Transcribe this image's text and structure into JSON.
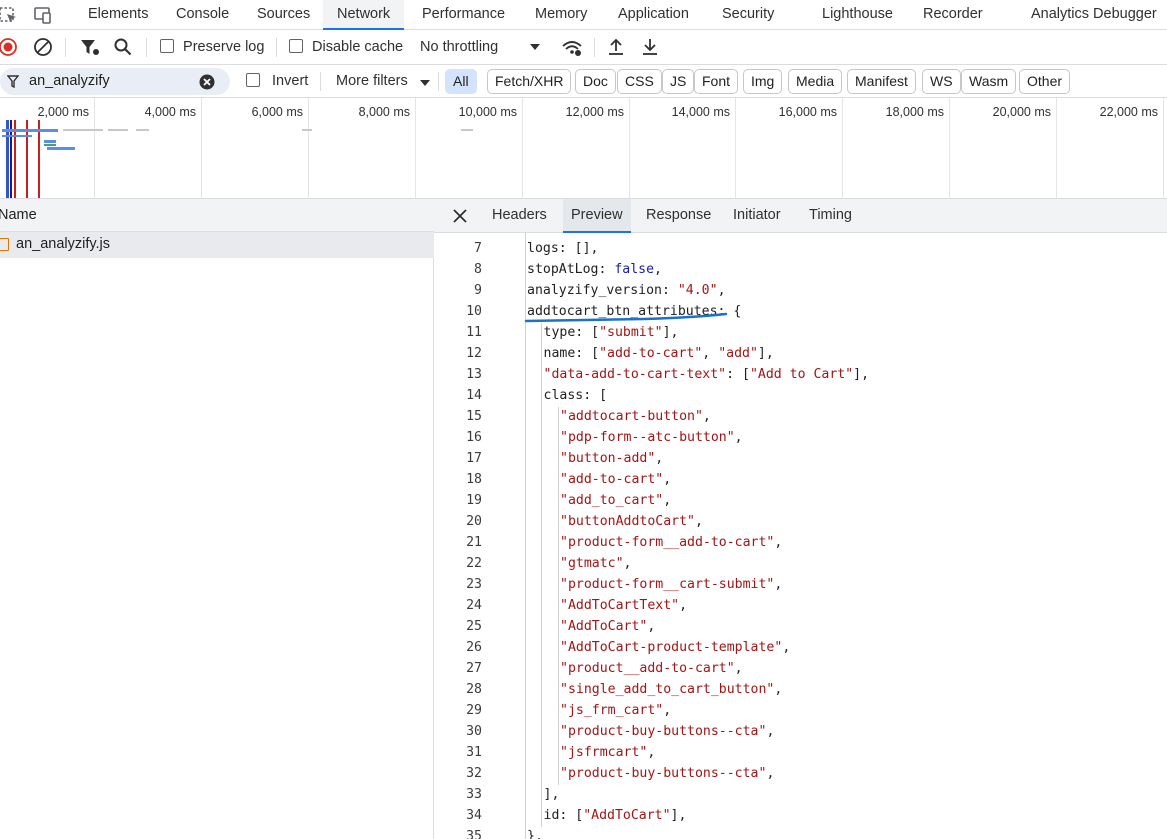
{
  "tabbar": {
    "tabs": [
      "Elements",
      "Console",
      "Sources",
      "Network",
      "Performance",
      "Memory",
      "Application",
      "Security",
      "Lighthouse",
      "Recorder",
      "Analytics Debugger"
    ],
    "active": "Network"
  },
  "toolbar": {
    "preserve_log": "Preserve log",
    "disable_cache": "Disable cache",
    "throttling": "No throttling"
  },
  "filterbar": {
    "filter_value": "an_analyzify",
    "invert": "Invert",
    "more_filters": "More filters",
    "types": [
      "All",
      "Fetch/XHR",
      "Doc",
      "CSS",
      "JS",
      "Font",
      "Img",
      "Media",
      "Manifest",
      "WS",
      "Wasm",
      "Other"
    ]
  },
  "overview": {
    "ticks": [
      "2,000 ms",
      "4,000 ms",
      "6,000 ms",
      "8,000 ms",
      "10,000 ms",
      "12,000 ms",
      "14,000 ms",
      "16,000 ms",
      "18,000 ms",
      "20,000 ms",
      "22,000 ms"
    ]
  },
  "requests": {
    "name_header": "Name",
    "items": [
      "an_analyzify.js"
    ]
  },
  "details": {
    "tabs": [
      "Headers",
      "Preview",
      "Response",
      "Initiator",
      "Timing"
    ],
    "active": "Preview"
  },
  "code": {
    "lines": [
      {
        "n": "7",
        "indent": 0,
        "parts": [
          [
            "p",
            "logs: [],"
          ]
        ]
      },
      {
        "n": "8",
        "indent": 0,
        "parts": [
          [
            "p",
            "stopAtLog: "
          ],
          [
            "k",
            "false"
          ],
          [
            "p",
            ","
          ]
        ]
      },
      {
        "n": "9",
        "indent": 0,
        "parts": [
          [
            "p",
            "analyzify_version: "
          ],
          [
            "s",
            "\"4.0\""
          ],
          [
            "p",
            ","
          ]
        ]
      },
      {
        "n": "10",
        "indent": 0,
        "parts": [
          [
            "p",
            "addtocart_btn_attributes: {"
          ]
        ]
      },
      {
        "n": "11",
        "indent": 1,
        "parts": [
          [
            "p",
            "type: ["
          ],
          [
            "s",
            "\"submit\""
          ],
          [
            "p",
            "],"
          ]
        ]
      },
      {
        "n": "12",
        "indent": 1,
        "parts": [
          [
            "p",
            "name: ["
          ],
          [
            "s",
            "\"add-to-cart\""
          ],
          [
            "p",
            ", "
          ],
          [
            "s",
            "\"add\""
          ],
          [
            "p",
            "],"
          ]
        ]
      },
      {
        "n": "13",
        "indent": 1,
        "parts": [
          [
            "s",
            "\"data-add-to-cart-text\""
          ],
          [
            "p",
            ": ["
          ],
          [
            "s",
            "\"Add to Cart\""
          ],
          [
            "p",
            "],"
          ]
        ]
      },
      {
        "n": "14",
        "indent": 1,
        "parts": [
          [
            "p",
            "class: ["
          ]
        ]
      },
      {
        "n": "15",
        "indent": 2,
        "parts": [
          [
            "s",
            "\"addtocart-button\""
          ],
          [
            "p",
            ","
          ]
        ]
      },
      {
        "n": "16",
        "indent": 2,
        "parts": [
          [
            "s",
            "\"pdp-form--atc-button\""
          ],
          [
            "p",
            ","
          ]
        ]
      },
      {
        "n": "17",
        "indent": 2,
        "parts": [
          [
            "s",
            "\"button-add\""
          ],
          [
            "p",
            ","
          ]
        ]
      },
      {
        "n": "18",
        "indent": 2,
        "parts": [
          [
            "s",
            "\"add-to-cart\""
          ],
          [
            "p",
            ","
          ]
        ]
      },
      {
        "n": "19",
        "indent": 2,
        "parts": [
          [
            "s",
            "\"add_to_cart\""
          ],
          [
            "p",
            ","
          ]
        ]
      },
      {
        "n": "20",
        "indent": 2,
        "parts": [
          [
            "s",
            "\"buttonAddtoCart\""
          ],
          [
            "p",
            ","
          ]
        ]
      },
      {
        "n": "21",
        "indent": 2,
        "parts": [
          [
            "s",
            "\"product-form__add-to-cart\""
          ],
          [
            "p",
            ","
          ]
        ]
      },
      {
        "n": "22",
        "indent": 2,
        "parts": [
          [
            "s",
            "\"gtmatc\""
          ],
          [
            "p",
            ","
          ]
        ]
      },
      {
        "n": "23",
        "indent": 2,
        "parts": [
          [
            "s",
            "\"product-form__cart-submit\""
          ],
          [
            "p",
            ","
          ]
        ]
      },
      {
        "n": "24",
        "indent": 2,
        "parts": [
          [
            "s",
            "\"AddToCartText\""
          ],
          [
            "p",
            ","
          ]
        ]
      },
      {
        "n": "25",
        "indent": 2,
        "parts": [
          [
            "s",
            "\"AddToCart\""
          ],
          [
            "p",
            ","
          ]
        ]
      },
      {
        "n": "26",
        "indent": 2,
        "parts": [
          [
            "s",
            "\"AddToCart-product-template\""
          ],
          [
            "p",
            ","
          ]
        ]
      },
      {
        "n": "27",
        "indent": 2,
        "parts": [
          [
            "s",
            "\"product__add-to-cart\""
          ],
          [
            "p",
            ","
          ]
        ]
      },
      {
        "n": "28",
        "indent": 2,
        "parts": [
          [
            "s",
            "\"single_add_to_cart_button\""
          ],
          [
            "p",
            ","
          ]
        ]
      },
      {
        "n": "29",
        "indent": 2,
        "parts": [
          [
            "s",
            "\"js_frm_cart\""
          ],
          [
            "p",
            ","
          ]
        ]
      },
      {
        "n": "30",
        "indent": 2,
        "parts": [
          [
            "s",
            "\"product-buy-buttons--cta\""
          ],
          [
            "p",
            ","
          ]
        ]
      },
      {
        "n": "31",
        "indent": 2,
        "parts": [
          [
            "s",
            "\"jsfrmcart\""
          ],
          [
            "p",
            ","
          ]
        ]
      },
      {
        "n": "32",
        "indent": 2,
        "parts": [
          [
            "s",
            "\"product-buy-buttons--cta\""
          ],
          [
            "p",
            ","
          ]
        ]
      },
      {
        "n": "33",
        "indent": 1,
        "parts": [
          [
            "p",
            "],"
          ]
        ]
      },
      {
        "n": "34",
        "indent": 1,
        "parts": [
          [
            "p",
            "id: ["
          ],
          [
            "s",
            "\"AddToCart\""
          ],
          [
            "p",
            "],"
          ]
        ]
      },
      {
        "n": "35",
        "indent": 0,
        "parts": [
          [
            "p",
            "},"
          ]
        ]
      }
    ]
  },
  "colors": {
    "accent": "#1a73e8",
    "string": "#a31515",
    "keyword": "#1a1aa6",
    "annotation": "#1a73c8"
  }
}
